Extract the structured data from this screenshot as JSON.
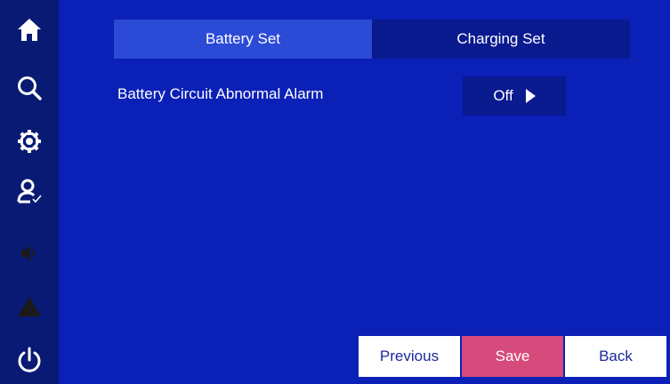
{
  "sidebar": {
    "icons": [
      {
        "name": "home-icon"
      },
      {
        "name": "search-icon"
      },
      {
        "name": "gear-icon"
      },
      {
        "name": "user-check-icon"
      },
      {
        "name": "speaker-icon"
      },
      {
        "name": "warning-icon"
      },
      {
        "name": "power-icon"
      }
    ]
  },
  "tabs": {
    "battery_set": "Battery Set",
    "charging_set": "Charging Set"
  },
  "settings": {
    "alarm_label": "Battery Circuit Abnormal Alarm",
    "alarm_value": "Off"
  },
  "footer": {
    "previous_label": "Previous",
    "save_label": "Save",
    "back_label": "Back"
  },
  "colors": {
    "background": "#0b20b6",
    "sidebar": "#081a73",
    "active_tab": "#2b4ad6",
    "save_button": "#d64a7c"
  }
}
